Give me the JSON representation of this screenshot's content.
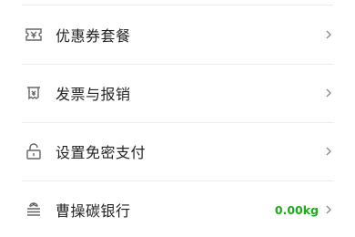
{
  "menu": {
    "items": [
      {
        "label": "优惠券套餐",
        "icon": "ticket-icon",
        "value": ""
      },
      {
        "label": "发票与报销",
        "icon": "invoice-icon",
        "value": ""
      },
      {
        "label": "设置免密支付",
        "icon": "unlock-icon",
        "value": ""
      },
      {
        "label": "曹操碳银行",
        "icon": "carbon-bank-icon",
        "value": "0.00kg"
      }
    ]
  },
  "colors": {
    "value_green": "#1aad19",
    "text": "#222222",
    "icon": "#666666",
    "chevron": "#888888"
  }
}
